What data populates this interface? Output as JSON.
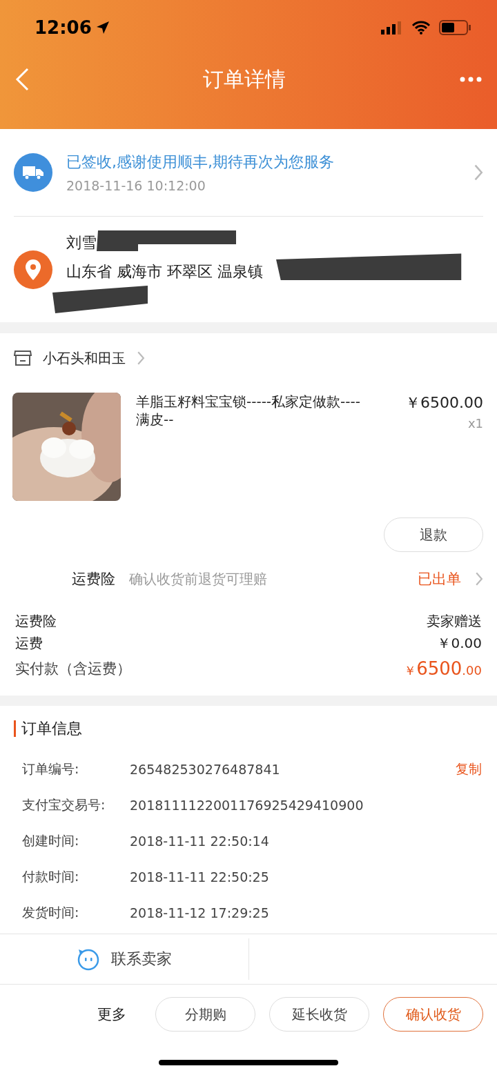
{
  "status_bar": {
    "time": "12:06"
  },
  "nav": {
    "title": "订单详情"
  },
  "logistics": {
    "status": "已签收,感谢使用顺丰,期待再次为您服务",
    "time": "2018-11-16 10:12:00"
  },
  "address": {
    "name": "刘雪",
    "region": "山东省 威海市 环翠区 温泉镇"
  },
  "shop": {
    "name": "小石头和田玉"
  },
  "product": {
    "kind": "picture",
    "title": "羊脂玉籽料宝宝锁-----私家定做款----满皮--",
    "price": "￥6500.00",
    "quantity": "x1",
    "refund_button": "退款"
  },
  "insurance": {
    "label": "运费险",
    "description": "确认收货前退货可理赔",
    "status": "已出单"
  },
  "fees": [
    {
      "label": "运费险",
      "value": "卖家赠送"
    },
    {
      "label": "运费",
      "value": "￥0.00"
    }
  ],
  "total": {
    "label": "实付款（含运费）",
    "currency": "￥",
    "integer": "6500",
    "decimal": ".00"
  },
  "order_info": {
    "title": "订单信息",
    "copy": "复制",
    "rows": [
      {
        "label": "订单编号:",
        "value": "265482530276487841"
      },
      {
        "label": "支付宝交易号:",
        "value": "2018111122001176925429410900"
      },
      {
        "label": "创建时间:",
        "value": "2018-11-11 22:50:14"
      },
      {
        "label": "付款时间:",
        "value": "2018-11-11 22:50:25"
      },
      {
        "label": "发货时间:",
        "value": "2018-11-12 17:29:25"
      }
    ]
  },
  "contact": {
    "label": "联系卖家"
  },
  "actions": {
    "more": "更多",
    "buttons": [
      {
        "label": "分期购",
        "primary": false
      },
      {
        "label": "延长收货",
        "primary": false
      },
      {
        "label": "确认收货",
        "primary": true
      }
    ]
  }
}
